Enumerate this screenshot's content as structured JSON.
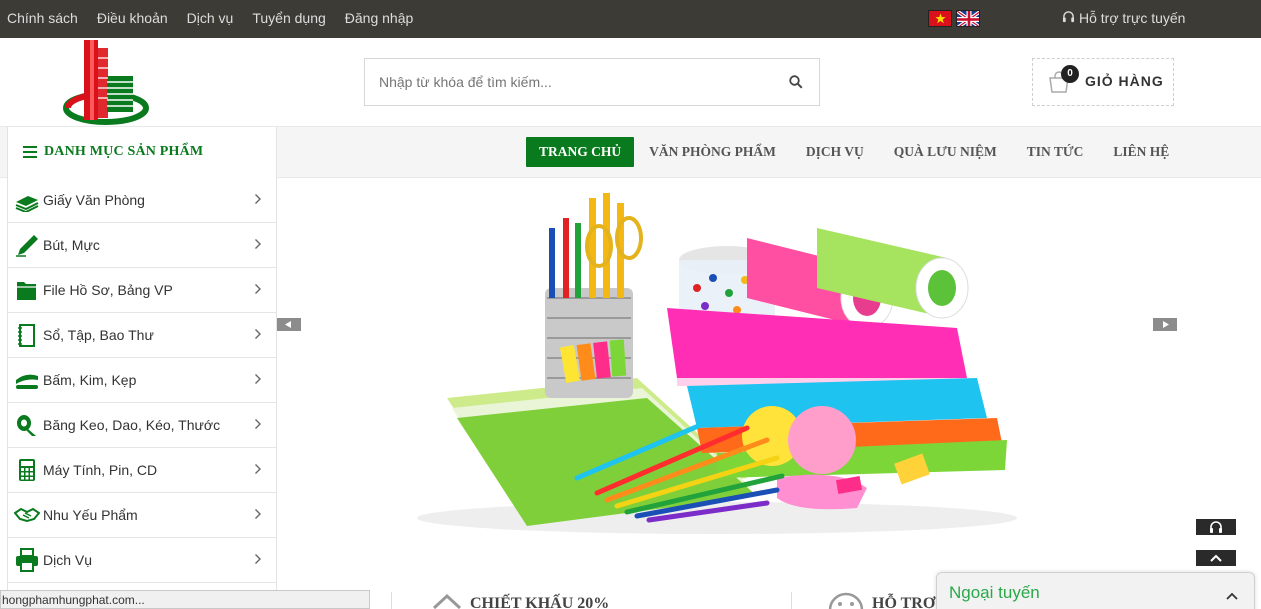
{
  "topbar": {
    "links": [
      "Chính sách",
      "Điều khoản",
      "Dịch vụ",
      "Tuyển dụng",
      "Đăng nhập"
    ],
    "support_label": "Hỗ trợ trực tuyến"
  },
  "search": {
    "placeholder": "Nhập từ khóa để tìm kiếm..."
  },
  "cart": {
    "count": "0",
    "label": "GIỎ HÀNG"
  },
  "category_menu": {
    "title": "DANH MỤC SẢN PHẨM",
    "items": [
      {
        "label": "Giấy Văn Phòng",
        "icon": "paper-stack-icon"
      },
      {
        "label": "Bút, Mực",
        "icon": "pen-icon"
      },
      {
        "label": "File Hồ Sơ, Bảng VP",
        "icon": "folder-icon"
      },
      {
        "label": "Sổ, Tập, Bao Thư",
        "icon": "notebook-icon"
      },
      {
        "label": "Bấm, Kim, Kẹp",
        "icon": "stapler-icon"
      },
      {
        "label": "Băng Keo, Dao, Kéo, Thước",
        "icon": "tape-icon"
      },
      {
        "label": "Máy Tính, Pin, CD",
        "icon": "calculator-icon"
      },
      {
        "label": "Nhu Yếu Phẩm",
        "icon": "handshake-icon"
      },
      {
        "label": "Dịch Vụ",
        "icon": "printer-icon"
      }
    ]
  },
  "main_nav": [
    "TRANG CHỦ",
    "VĂN PHÒNG PHẨM",
    "DỊCH VỤ",
    "QUÀ LƯU NIỆM",
    "TIN TỨC",
    "LIÊN HỆ"
  ],
  "features": [
    "CHIẾT KHẤU 20%",
    "HỖ TRỢ"
  ],
  "status_bar": "hongphamhungphat.com...",
  "chat": {
    "label": "Ngoại tuyến"
  },
  "colors": {
    "brand_green": "#0a7a1e",
    "topbar": "#3d3b36",
    "chat_green": "#2aa84a"
  }
}
